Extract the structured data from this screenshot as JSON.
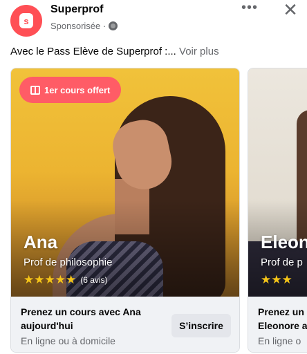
{
  "header": {
    "brand_name": "Superprof",
    "sponsored_label": "Sponsorisée ·",
    "more_icon": "•••",
    "close_icon": "✕"
  },
  "post": {
    "text": "Avec le Pass Elève de Superprof :...",
    "see_more": "Voir plus"
  },
  "colors": {
    "brand": "#ff4f55",
    "badge": "#ff5c66",
    "star": "#f5c518"
  },
  "cards": [
    {
      "badge_label": "1er cours offert",
      "name": "Ana",
      "role": "Prof de philosophie",
      "rating": 5,
      "stars": "★★★★★",
      "reviews": "(6 avis)",
      "cta_title": "Prenez un cours avec Ana aujourd'hui",
      "cta_subtitle": "En ligne ou à domicile",
      "button_label": "S’inscrire"
    },
    {
      "name": "Eleon",
      "role": "Prof de p",
      "stars": "★★★",
      "cta_title": "Prenez un",
      "cta_title_line2": "Eleonore a",
      "cta_subtitle": "En ligne o"
    }
  ]
}
